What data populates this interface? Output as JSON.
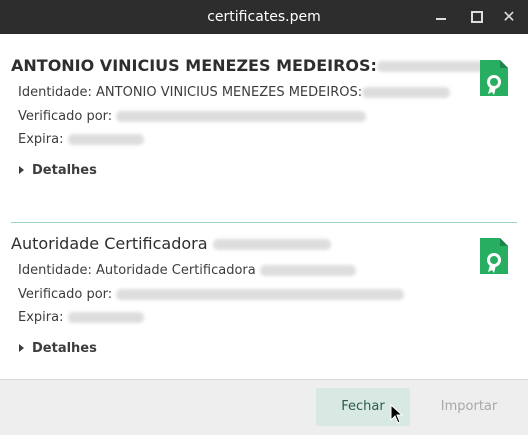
{
  "window": {
    "title": "certificates.pem",
    "minimize_label": "minimize",
    "maximize_label": "maximize",
    "close_label": "close"
  },
  "certificates": [
    {
      "name": "ANTONIO VINICIUS MENEZES MEDEIROS:",
      "identity_label": "Identidade:",
      "identity_value": "ANTONIO VINICIUS MENEZES MEDEIROS:",
      "verified_label": "Verificado por:",
      "expires_label": "Expira:",
      "details_label": "Detalhes",
      "icon": "certificate-icon"
    },
    {
      "name": "Autoridade Certificadora",
      "identity_label": "Identidade:",
      "identity_value": "Autoridade Certificadora",
      "verified_label": "Verificado por:",
      "expires_label": "Expira:",
      "details_label": "Detalhes",
      "icon": "certificate-icon"
    }
  ],
  "footer": {
    "close_button": "Fechar",
    "import_button": "Importar"
  },
  "colors": {
    "accent_green": "#27ae60",
    "separator": "#9fd4c4",
    "close_button_bg": "#d8e8e3"
  }
}
